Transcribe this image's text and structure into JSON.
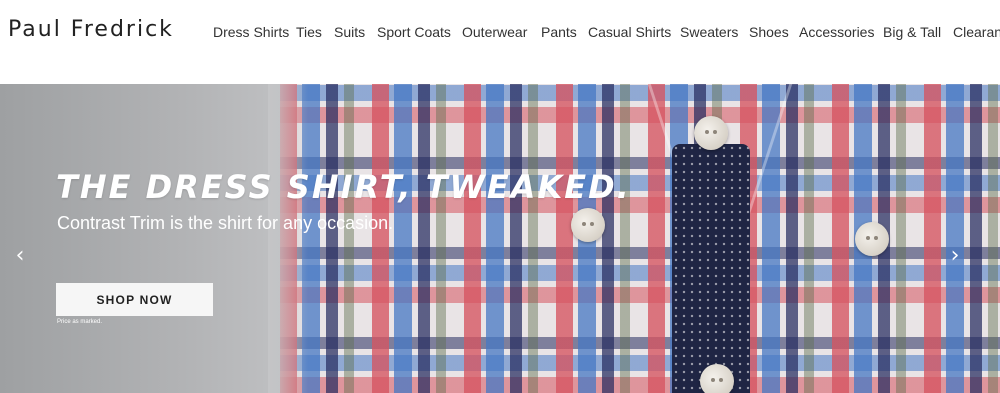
{
  "brand": {
    "logo_text": "Paul Fredrick"
  },
  "nav": {
    "items": [
      {
        "label": "Dress Shirts"
      },
      {
        "label": "Ties"
      },
      {
        "label": "Suits"
      },
      {
        "label": "Sport Coats"
      },
      {
        "label": "Outerwear"
      },
      {
        "label": "Pants"
      },
      {
        "label": "Casual Shirts"
      },
      {
        "label": "Sweaters"
      },
      {
        "label": "Shoes"
      },
      {
        "label": "Accessories"
      },
      {
        "label": "Big & Tall"
      },
      {
        "label": "Clearan"
      }
    ]
  },
  "hero": {
    "title": "THE DRESS SHIRT, TWEAKED.",
    "subtitle": "Contrast Trim is the shirt for any occasion.",
    "cta_label": "SHOP NOW",
    "fine_print": "Price as marked.",
    "prev_icon": "chevron-left-icon",
    "next_icon": "chevron-right-icon"
  }
}
